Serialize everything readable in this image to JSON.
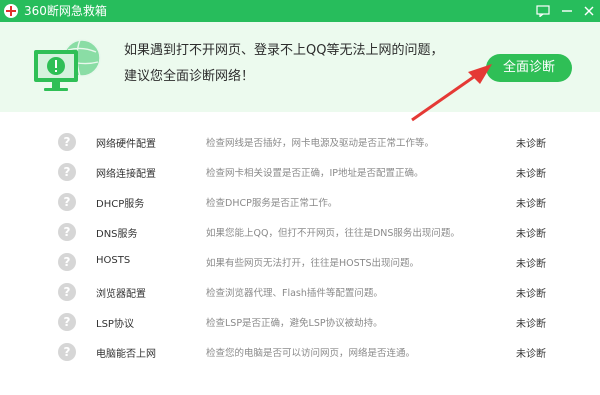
{
  "window": {
    "title": "360断网急救箱",
    "logo_icon": "red-cross-icon",
    "buttons": [
      "feedback-icon",
      "minimize-icon",
      "close-icon"
    ]
  },
  "banner": {
    "line1": "如果遇到打不开网页、登录不上QQ等无法上网的问题，",
    "line2": "建议您全面诊断网络！",
    "button_label": "全面诊断",
    "illustration_icon": "monitor-warning-globe-icon"
  },
  "colors": {
    "titlebar": "#27bd5c",
    "banner_bg": "#ecfaee",
    "button": "#2fbf56",
    "arrow": "#e53935",
    "status_icon": "#d6d6d6"
  },
  "checks": [
    {
      "name": "网络硬件配置",
      "desc": "检查网线是否插好，网卡电源及驱动是否正常工作等。",
      "status": "未诊断",
      "icon": "?"
    },
    {
      "name": "网络连接配置",
      "desc": "检查网卡相关设置是否正确，IP地址是否配置正确。",
      "status": "未诊断",
      "icon": "?"
    },
    {
      "name": "DHCP服务",
      "desc": "检查DHCP服务是否正常工作。",
      "status": "未诊断",
      "icon": "?"
    },
    {
      "name": "DNS服务",
      "desc": "如果您能上QQ，但打不开网页，往往是DNS服务出现问题。",
      "status": "未诊断",
      "icon": "?"
    },
    {
      "name": "HOSTS",
      "desc": "如果有些网页无法打开，往往是HOSTS出现问题。",
      "status": "未诊断",
      "icon": "?"
    },
    {
      "name": "浏览器配置",
      "desc": "检查浏览器代理、Flash插件等配置问题。",
      "status": "未诊断",
      "icon": "?"
    },
    {
      "name": "LSP协议",
      "desc": "检查LSP是否正确，避免LSP协议被劫持。",
      "status": "未诊断",
      "icon": "?"
    },
    {
      "name": "电脑能否上网",
      "desc": "检查您的电脑是否可以访问网页，网络是否连通。",
      "status": "未诊断",
      "icon": "?"
    }
  ]
}
